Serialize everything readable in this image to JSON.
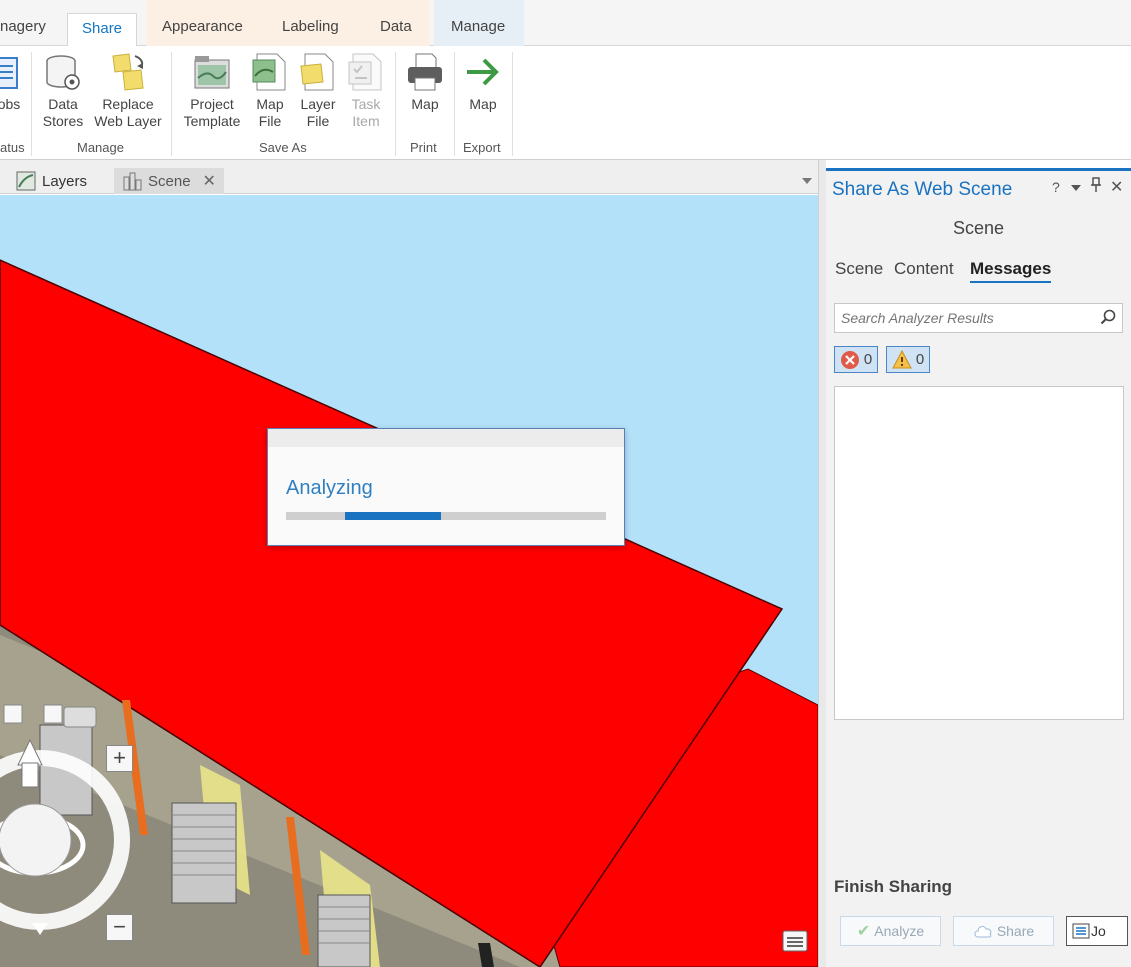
{
  "ribbon": {
    "tabs": [
      {
        "label": "nagery"
      },
      {
        "label": "Share"
      },
      {
        "label": "Appearance"
      },
      {
        "label": "Labeling"
      },
      {
        "label": "Data"
      },
      {
        "label": "Manage"
      }
    ],
    "partial_left": {
      "top": "obs",
      "bottom": "atus"
    },
    "buttons": {
      "data_stores": {
        "line1": "Data",
        "line2": "Stores"
      },
      "replace_web_layer": {
        "line1": "Replace",
        "line2": "Web Layer"
      },
      "project_template": {
        "line1": "Project",
        "line2": "Template"
      },
      "map_file": {
        "line1": "Map",
        "line2": "File"
      },
      "layer_file": {
        "line1": "Layer",
        "line2": "File"
      },
      "task_item": {
        "line1": "Task",
        "line2": "Item"
      },
      "print_map": {
        "line1": "Map"
      },
      "export_map": {
        "line1": "Map"
      }
    },
    "groups": {
      "manage": "Manage",
      "save_as": "Save As",
      "print": "Print",
      "export": "Export"
    }
  },
  "view_tabs": {
    "layers": "Layers",
    "scene": "Scene"
  },
  "dialog": {
    "title": "Analyzing",
    "progress": 0.3
  },
  "pane": {
    "title": "Share As Web Scene",
    "help": "?",
    "subtitle": "Scene",
    "tabs": {
      "scene": "Scene",
      "content": "Content",
      "messages": "Messages"
    },
    "search_placeholder": "Search Analyzer Results",
    "error_count": "0",
    "warning_count": "0",
    "finish_heading": "Finish Sharing",
    "analyze_label": "Analyze",
    "share_label": "Share",
    "jobs_label": "Jo"
  },
  "colors": {
    "accent": "#1a73c1",
    "sky": "#b4e1fa",
    "roof": "#ff0000"
  }
}
